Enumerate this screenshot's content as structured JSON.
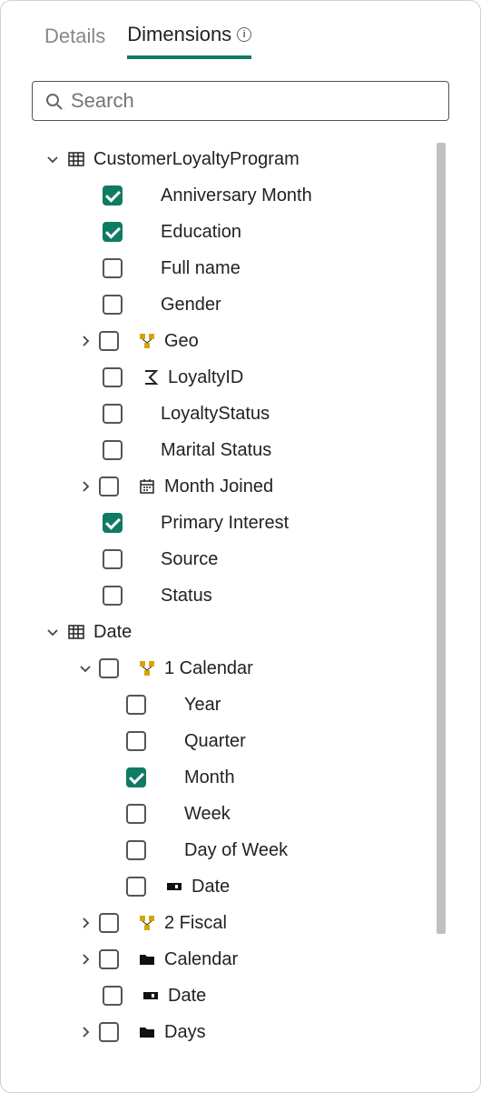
{
  "tabs": {
    "details": "Details",
    "dimensions": "Dimensions"
  },
  "search": {
    "placeholder": "Search"
  },
  "tree": {
    "t0": {
      "label": "CustomerLoyaltyProgram"
    },
    "t0_0": {
      "label": "Anniversary Month"
    },
    "t0_1": {
      "label": "Education"
    },
    "t0_2": {
      "label": "Full name"
    },
    "t0_3": {
      "label": "Gender"
    },
    "t0_4": {
      "label": "Geo"
    },
    "t0_5": {
      "label": "LoyaltyID"
    },
    "t0_6": {
      "label": "LoyaltyStatus"
    },
    "t0_7": {
      "label": "Marital Status"
    },
    "t0_8": {
      "label": "Month Joined"
    },
    "t0_9": {
      "label": "Primary Interest"
    },
    "t0_10": {
      "label": "Source"
    },
    "t0_11": {
      "label": "Status"
    },
    "t1": {
      "label": "Date"
    },
    "t1_0": {
      "label": "1 Calendar"
    },
    "t1_0_0": {
      "label": "Year"
    },
    "t1_0_1": {
      "label": "Quarter"
    },
    "t1_0_2": {
      "label": "Month"
    },
    "t1_0_3": {
      "label": "Week"
    },
    "t1_0_4": {
      "label": "Day of Week"
    },
    "t1_0_5": {
      "label": "Date"
    },
    "t1_1": {
      "label": "2 Fiscal"
    },
    "t1_2": {
      "label": "Calendar"
    },
    "t1_3": {
      "label": "Date"
    },
    "t1_4": {
      "label": "Days"
    }
  }
}
